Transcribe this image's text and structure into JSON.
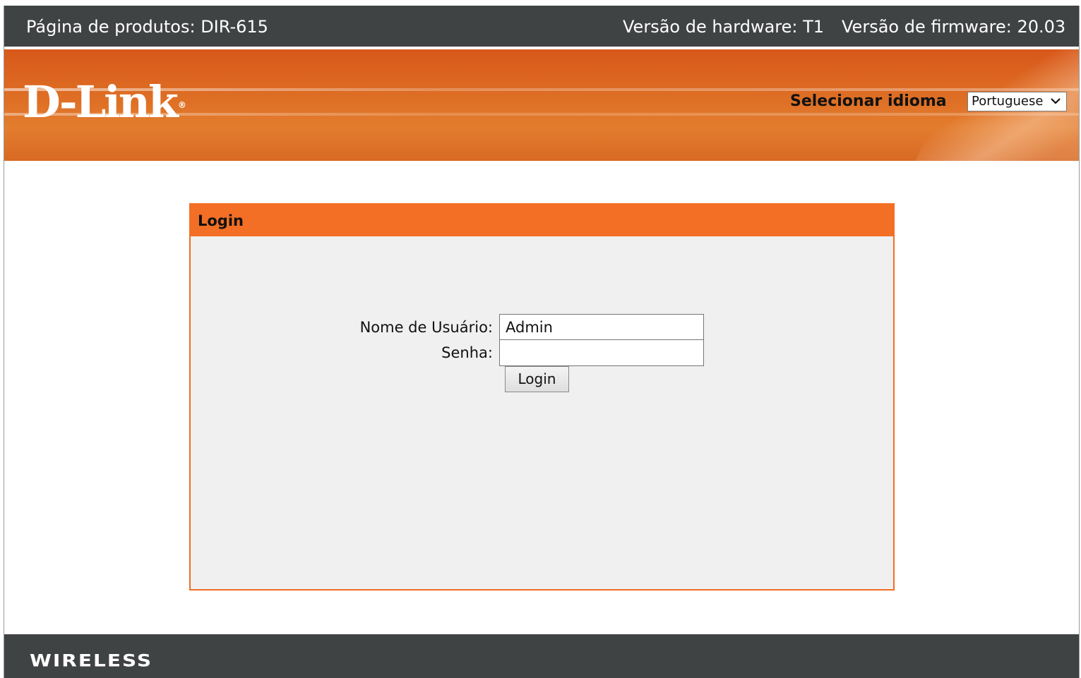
{
  "topbar": {
    "product": "Página de produtos: DIR-615",
    "hardware": "Versão de hardware: T1",
    "firmware": "Versão de firmware: 20.03"
  },
  "banner": {
    "logo": "D-Link",
    "logo_mark": "®",
    "language_label": "Selecionar idioma",
    "language_selected": "Portuguese",
    "chevron_icon": "chevron-down-icon"
  },
  "login": {
    "title": "Login",
    "username_label": "Nome de Usuário:",
    "username_value": "Admin",
    "password_label": "Senha:",
    "password_value": "",
    "button_label": "Login"
  },
  "footer": {
    "brand": "WIRELESS"
  },
  "colors": {
    "accent": "#f36f25",
    "bar": "#404344"
  }
}
